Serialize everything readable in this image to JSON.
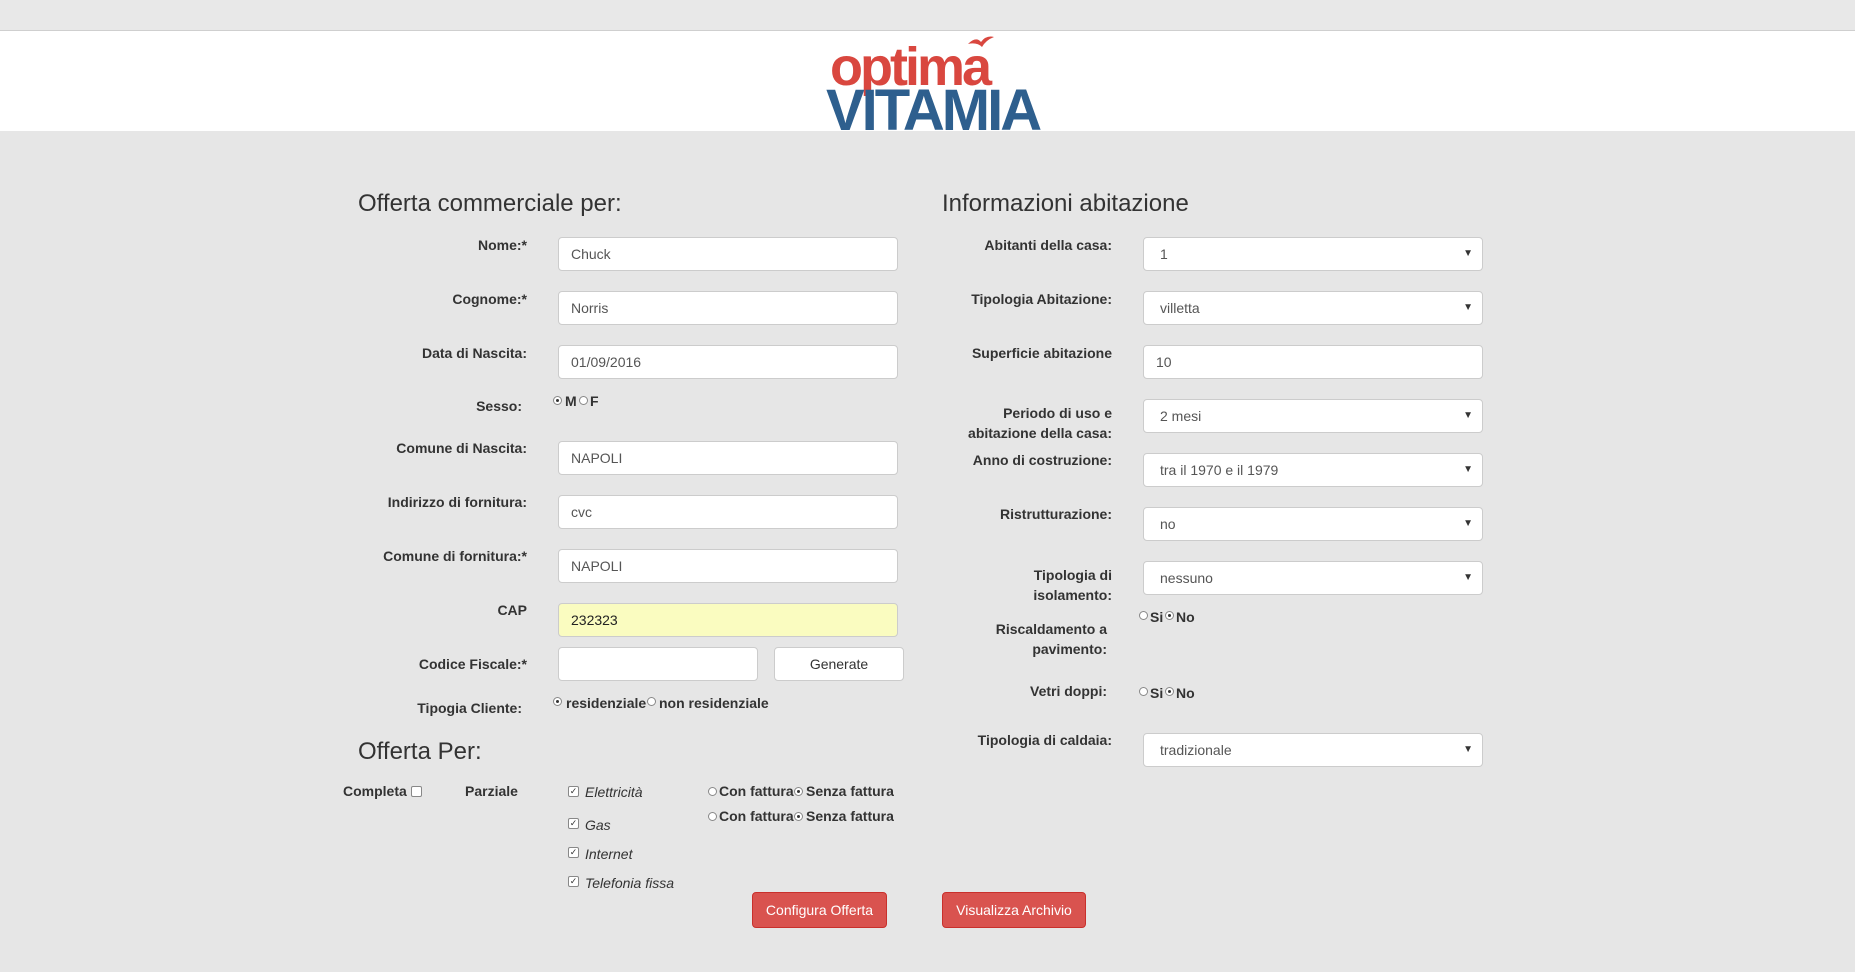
{
  "logo": {
    "top": "optima",
    "bottom": "VITAMIA"
  },
  "left": {
    "title": "Offerta commerciale per:",
    "nome_label": "Nome:*",
    "nome_value": "Chuck",
    "cognome_label": "Cognome:*",
    "cognome_value": "Norris",
    "nascita_label": "Data di Nascita:",
    "nascita_value": "01/09/2016",
    "sesso_label": "Sesso:",
    "sesso_m": "M",
    "sesso_f": "F",
    "comune_nascita_label": "Comune di Nascita:",
    "comune_nascita_value": "NAPOLI",
    "indirizzo_label": "Indirizzo di fornitura:",
    "indirizzo_value": "cvc",
    "comune_fornitura_label": "Comune di fornitura:*",
    "comune_fornitura_value": "NAPOLI",
    "cap_label": "CAP",
    "cap_value": "232323",
    "cf_label": "Codice Fiscale:*",
    "cf_value": "",
    "generate_label": "Generate",
    "tipogia_label": "Tipogia Cliente:",
    "residenziale": "residenziale",
    "non_residenziale": "non residenziale"
  },
  "offerta": {
    "title": "Offerta Per:",
    "completa": "Completa",
    "parziale": "Parziale",
    "items": [
      "Elettricità",
      "Gas",
      "Internet",
      "Telefonia fissa"
    ],
    "con_fattura": "Con fattura",
    "senza_fattura": "Senza fattura"
  },
  "right": {
    "title": "Informazioni abitazione",
    "abitanti_label": "Abitanti della casa:",
    "abitanti_value": "1",
    "tipologia_label": "Tipologia Abitazione:",
    "tipologia_value": "villetta",
    "superficie_label": "Superficie abitazione",
    "superficie_value": "10",
    "periodo_label_1": "Periodo di uso e",
    "periodo_label_2": "abitazione della casa:",
    "periodo_value": "2 mesi",
    "anno_label": "Anno di costruzione:",
    "anno_value": "tra il 1970 e il 1979",
    "ristrutturazione_label": "Ristrutturazione:",
    "ristrutturazione_value": "no",
    "isolamento_label_1": "Tipologia di",
    "isolamento_label_2": "isolamento:",
    "isolamento_value": "nessuno",
    "riscaldamento_label_1": "Riscaldamento a",
    "riscaldamento_label_2": "pavimento:",
    "si": "Si",
    "no": "No",
    "vetri_label": "Vetri doppi:",
    "caldaia_label": "Tipologia di caldaia:",
    "caldaia_value": "tradizionale"
  },
  "buttons": {
    "configura": "Configura Offerta",
    "archivio": "Visualizza Archivio"
  }
}
